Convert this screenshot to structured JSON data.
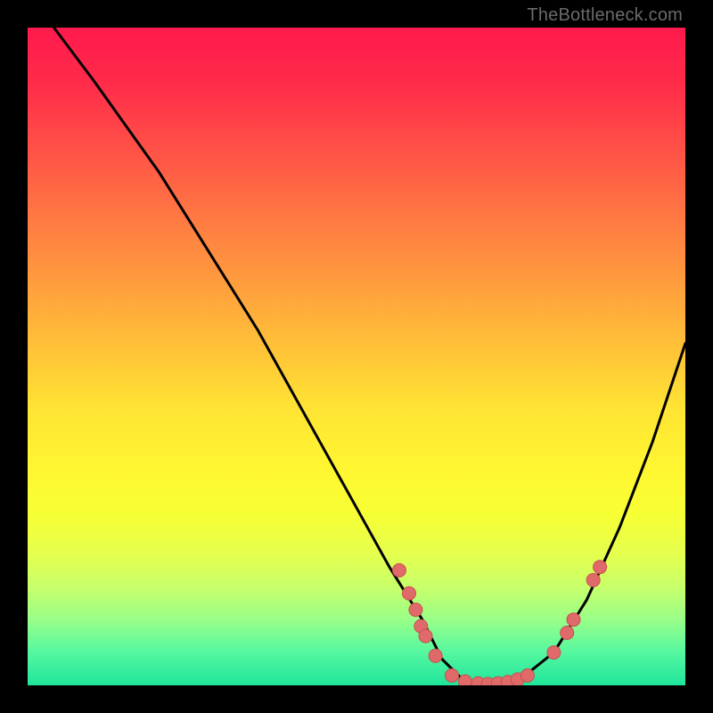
{
  "watermark": "TheBottleneck.com",
  "chart_data": {
    "type": "line",
    "title": "",
    "xlabel": "",
    "ylabel": "",
    "xlim": [
      0,
      100
    ],
    "ylim": [
      0,
      100
    ],
    "series": [
      {
        "name": "curve",
        "x": [
          4,
          10,
          15,
          20,
          25,
          30,
          35,
          40,
          45,
          50,
          55,
          60,
          63,
          66,
          70,
          75,
          80,
          85,
          90,
          95,
          100
        ],
        "values": [
          100,
          92,
          85,
          78,
          70,
          62,
          54,
          45,
          36,
          27,
          18,
          10,
          4,
          1,
          0,
          1,
          5,
          13,
          24,
          37,
          52
        ]
      }
    ],
    "markers": [
      {
        "x": 56.5,
        "y": 17.5
      },
      {
        "x": 58.0,
        "y": 14.0
      },
      {
        "x": 59.0,
        "y": 11.5
      },
      {
        "x": 59.8,
        "y": 9.0
      },
      {
        "x": 60.5,
        "y": 7.5
      },
      {
        "x": 62.0,
        "y": 4.5
      },
      {
        "x": 64.5,
        "y": 1.5
      },
      {
        "x": 66.5,
        "y": 0.6
      },
      {
        "x": 68.5,
        "y": 0.3
      },
      {
        "x": 70.0,
        "y": 0.2
      },
      {
        "x": 71.5,
        "y": 0.3
      },
      {
        "x": 73.0,
        "y": 0.5
      },
      {
        "x": 74.5,
        "y": 0.9
      },
      {
        "x": 76.0,
        "y": 1.5
      },
      {
        "x": 80.0,
        "y": 5.0
      },
      {
        "x": 82.0,
        "y": 8.0
      },
      {
        "x": 83.0,
        "y": 10.0
      },
      {
        "x": 86.0,
        "y": 16.0
      },
      {
        "x": 87.0,
        "y": 18.0
      }
    ],
    "colors": {
      "curve": "#000000",
      "marker_fill": "#e06a6a",
      "marker_stroke": "#c94f4f"
    }
  }
}
